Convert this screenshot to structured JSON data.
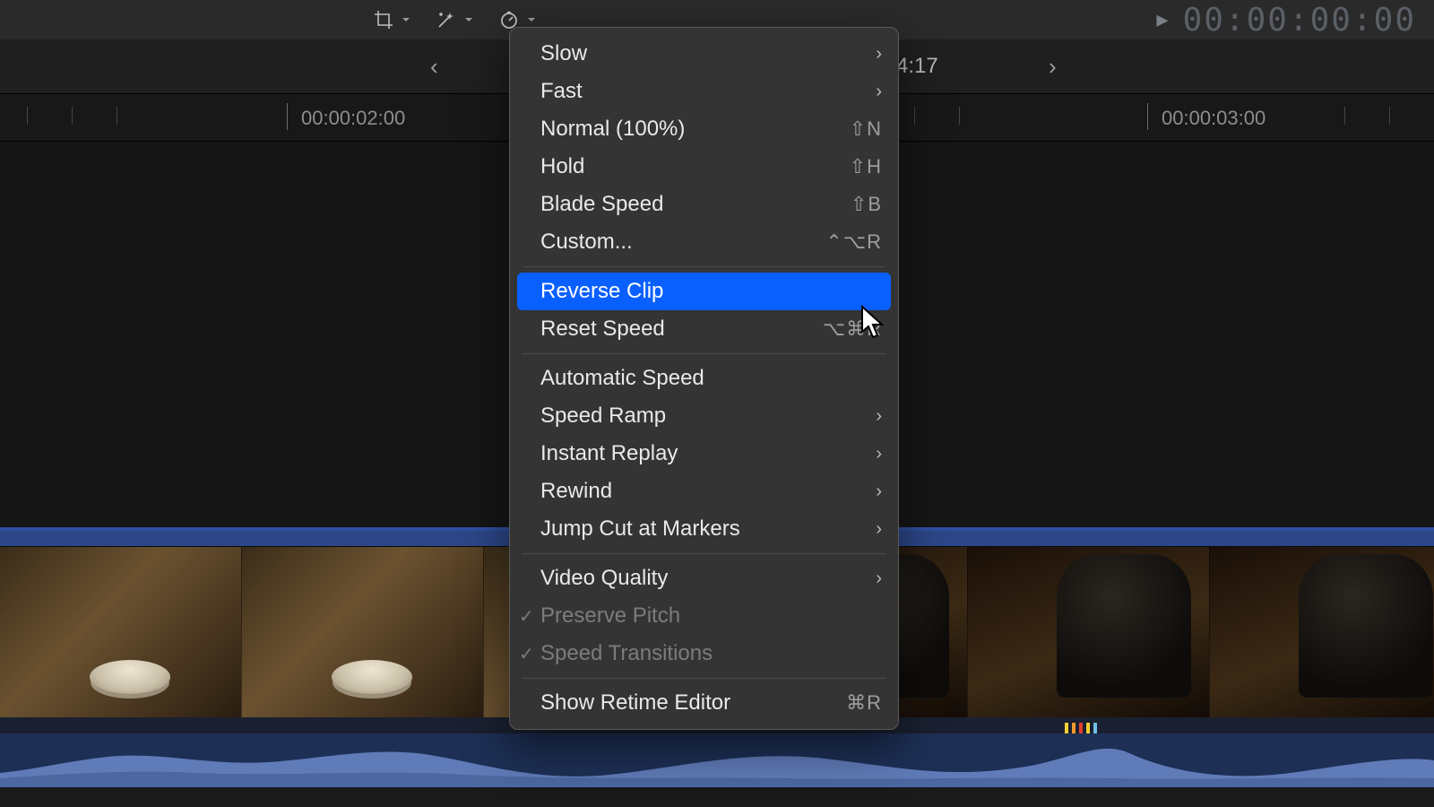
{
  "toolbar": {
    "timecode": "00:00:00:00"
  },
  "nav": {
    "center_text": "4:17"
  },
  "ruler": {
    "label_left": "00:00:02:00",
    "label_right": "00:00:03:00"
  },
  "menu": {
    "groups": [
      [
        {
          "label": "Slow",
          "submenu": true
        },
        {
          "label": "Fast",
          "submenu": true
        },
        {
          "label": "Normal (100%)",
          "shortcut": "⇧N"
        },
        {
          "label": "Hold",
          "shortcut": "⇧H"
        },
        {
          "label": "Blade Speed",
          "shortcut": "⇧B"
        },
        {
          "label": "Custom...",
          "shortcut": "⌃⌥R"
        }
      ],
      [
        {
          "label": "Reverse Clip",
          "selected": true
        },
        {
          "label": "Reset Speed",
          "shortcut": "⌥⌘R"
        }
      ],
      [
        {
          "label": "Automatic Speed"
        },
        {
          "label": "Speed Ramp",
          "submenu": true
        },
        {
          "label": "Instant Replay",
          "submenu": true
        },
        {
          "label": "Rewind",
          "submenu": true
        },
        {
          "label": "Jump Cut at Markers",
          "submenu": true
        }
      ],
      [
        {
          "label": "Video Quality",
          "submenu": true
        },
        {
          "label": "Preserve Pitch",
          "checked": true
        },
        {
          "label": "Speed Transitions",
          "checked": true
        }
      ],
      [
        {
          "label": "Show Retime Editor",
          "shortcut": "⌘R"
        }
      ]
    ]
  },
  "colors": {
    "accent": "#0a60ff"
  }
}
